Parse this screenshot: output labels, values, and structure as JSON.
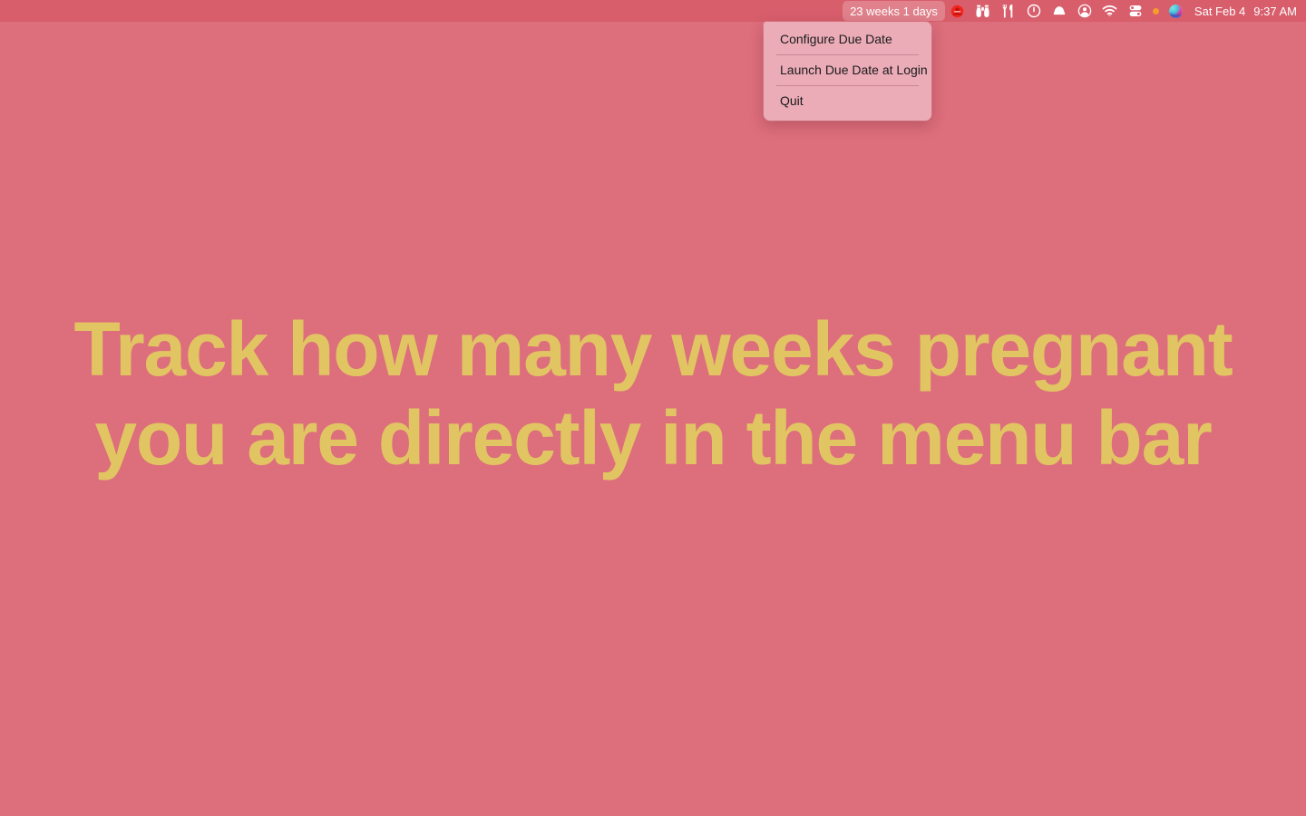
{
  "desktop": {
    "background_color": "#DD6E7C",
    "hero": {
      "text_color": "#E2C563",
      "line1": "Track how many weeks pregnant",
      "line2": "you are directly in the menu bar"
    }
  },
  "menubar": {
    "background_color": "#D85E6C",
    "text_color": "#FFFFFF",
    "status_item": {
      "label": "23 weeks 1 days",
      "active": true
    },
    "icons": [
      {
        "name": "do-not-disturb-icon",
        "label": "Do Not Disturb"
      },
      {
        "name": "binoculars-icon",
        "label": "Binoculars"
      },
      {
        "name": "fork-knife-icon",
        "label": "Fork and Knife"
      },
      {
        "name": "power-circle-icon",
        "label": "Power"
      },
      {
        "name": "bell-icon",
        "label": "Notifications"
      },
      {
        "name": "user-circle-icon",
        "label": "Account"
      },
      {
        "name": "wifi-icon",
        "label": "Wi-Fi"
      },
      {
        "name": "control-center-icon",
        "label": "Control Center"
      }
    ],
    "indicator_dot_color": "#F59D2B",
    "siri": {
      "name": "siri-orb-icon",
      "label": "Siri"
    },
    "clock": {
      "date": "Sat Feb 4",
      "time": "9:37 AM"
    }
  },
  "dropdown": {
    "background_color": "#EBACB8",
    "items": [
      {
        "label": "Configure Due Date"
      },
      {
        "label": "Launch Due Date at Login"
      },
      {
        "label": "Quit"
      }
    ]
  }
}
